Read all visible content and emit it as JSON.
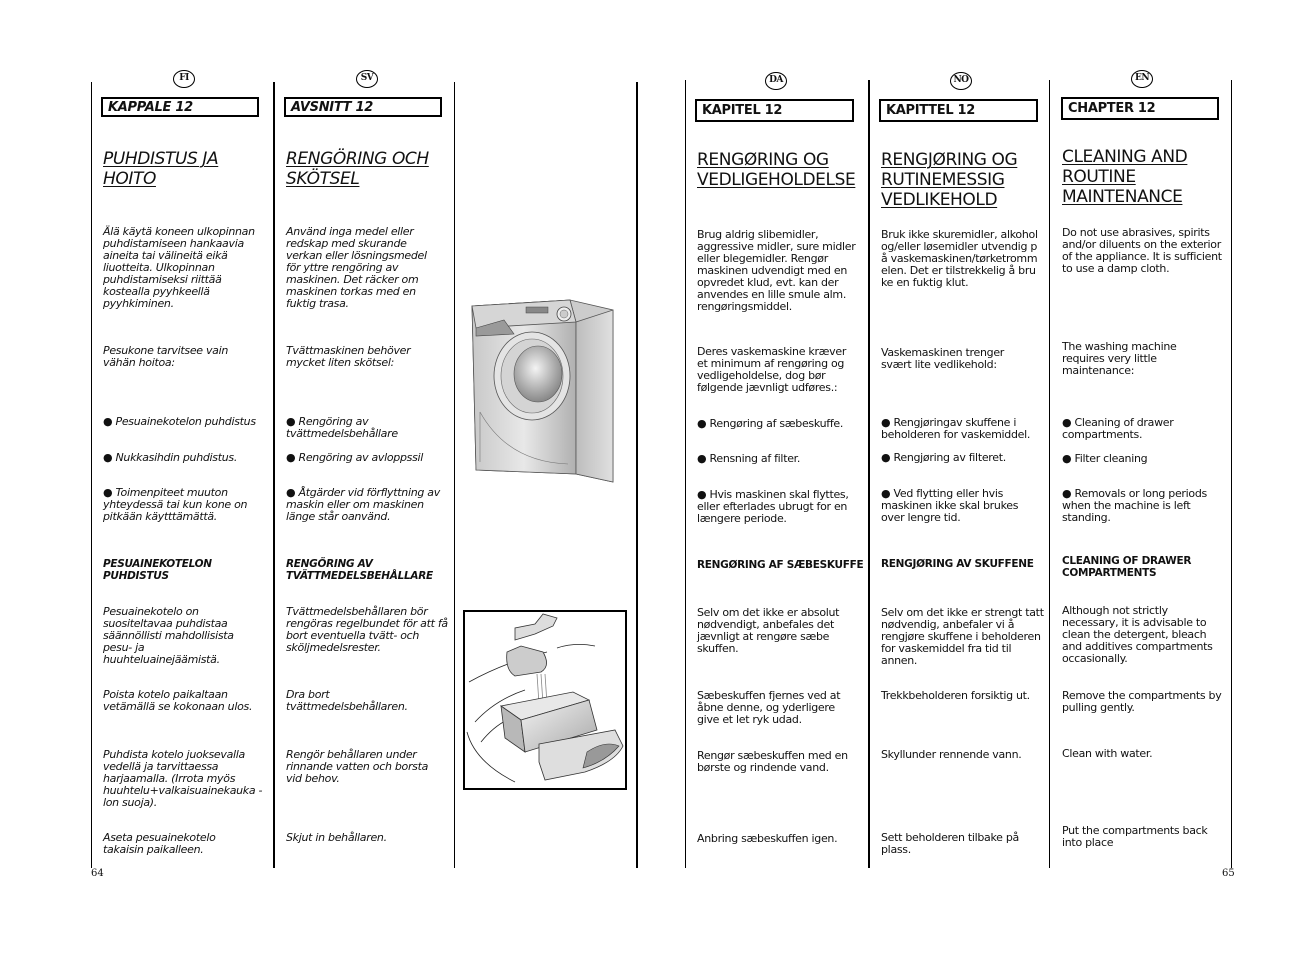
{
  "pages": {
    "left_number": "64",
    "right_number": "65"
  },
  "columns": {
    "fi": {
      "lang": "FI",
      "chapter": "KAPPALE 12",
      "title": "PUHDISTUS JA HOITO",
      "intro": "Älä käytä koneen ulkopinnan puhdistamiseen hankaavia aineita tai välineitä eikä liuotteita. Ulkopinnan puhdistamiseksi riittää kostealla pyyhkeellä pyyhkiminen.",
      "maintenance": "Pesukone tarvitsee vain vähän hoitoa:",
      "bullets": [
        "Pesuainekotelon puhdistus",
        "Nukkasihdin puhdistus.",
        "Toimenpiteet muuton yhteydessä tai kun kone on pitkään käytttämättä."
      ],
      "subheading": "PESUAINEKOTELON PUHDISTUS",
      "steps": [
        "Pesuainekotelo on suositeltavaa puhdistaa säännöllisti mahdollisista pesu- ja huuhteluainejäämistä.",
        "Poista kotelo paikaltaan vetämällä se kokonaan ulos.",
        "Puhdista kotelo juoksevalla vedellä ja tarvittaessa harjaamalla. (Irrota myös huuhtelu+valkaisuainekauka -lon suoja).",
        "Aseta pesuainekotelo takaisin paikalleen."
      ]
    },
    "sv": {
      "lang": "SV",
      "chapter": "AVSNITT 12",
      "title": "RENGÖRING OCH SKÖTSEL",
      "intro": "Använd inga medel eller redskap med skurande verkan eller lösningsmedel för yttre rengöring av maskinen. Det räcker om maskinen torkas med en fuktig trasa.",
      "maintenance": "Tvättmaskinen behöver mycket liten skötsel:",
      "bullets": [
        "Rengöring av tvättmedelsbehållare",
        "Rengöring av avloppssil",
        "Åtgärder vid förflyttning av maskin eller om maskinen länge står oanvänd."
      ],
      "subheading": "RENGÖRING AV TVÄTTMEDELSBEHÅLLARE",
      "steps": [
        "Tvättmedelsbehållaren bör rengöras regelbundet för att få bort eventuella tvätt- och sköljmedelsrester.",
        "Dra bort tvättmedelsbehållaren.",
        "Rengör behållaren under rinnande vatten och borsta vid behov.",
        "Skjut in behållaren."
      ]
    },
    "da": {
      "lang": "DA",
      "chapter": "KAPITEL 12",
      "title": "RENGØRING OG VEDLIGEHOLDELSE",
      "intro": "Brug aldrig slibemidler, aggressive midler, sure midler eller blegemidler. Rengør maskinen udvendigt med en opvredet klud, evt. kan der anvendes en lille smule alm. rengøringsmiddel.",
      "maintenance": "Deres vaskemaskine kræver et minimum af rengøring og vedligeholdelse, dog bør følgende jævnligt udføres.:",
      "bullets": [
        "Rengøring af sæbeskuffe.",
        "Rensning af filter.",
        "Hvis maskinen skal flyttes, eller efterlades ubrugt for en længere periode."
      ],
      "subheading": "RENGØRING AF SÆBESKUFFE",
      "steps": [
        "Selv om det ikke er absolut nødvendigt, anbefales det jævnligt at rengøre sæbe skuffen.",
        "Sæbeskuffen fjernes ved at åbne denne, og yderligere give et let ryk udad.",
        "Rengør sæbeskuffen med en børste og rindende vand.",
        "Anbring sæbeskuffen igen."
      ]
    },
    "no": {
      "lang": "NO",
      "chapter": "KAPITTEL 12",
      "title": "RENGJØRING OG RUTINEMESSIG VEDLIKEHOLD",
      "intro": "Bruk ikke skuremidler, alkohol og/eller løsemidler utvendig på vaskemaskinen/tørketromm elen. Det er tilstrekkelig å bruke en fuktig klut.",
      "maintenance": "Vaskemaskinen trenger svært lite vedlikehold:",
      "bullets": [
        "Rengjøringav skuffene i beholderen for vaskemiddel.",
        "Rengjøring av filteret.",
        "Ved flytting eller hvis maskinen ikke skal brukes over lengre tid."
      ],
      "subheading": "RENGJØRING AV SKUFFENE",
      "steps": [
        "Selv om det ikke er strengt tatt nødvendig, anbefaler vi å rengjøre skuffene i beholderen for vaskemiddel fra tid til annen.",
        "Trekkbeholderen forsiktig ut.",
        "Skyllunder rennende vann.",
        "Sett beholderen tilbake på plass."
      ]
    },
    "en": {
      "lang": "EN",
      "chapter": "CHAPTER 12",
      "title": "CLEANING AND ROUTINE MAINTENANCE",
      "intro": "Do not use abrasives, spirits and/or diluents on the exterior of the appliance. It is sufficient to use a damp cloth.",
      "maintenance": "The washing machine requires very little maintenance:",
      "bullets": [
        "Cleaning of drawer compartments.",
        "Filter cleaning",
        "Removals or long periods when the machine is left standing."
      ],
      "subheading": "CLEANING OF DRAWER COMPARTMENTS",
      "steps": [
        "Although not strictly necessary, it is advisable to clean the detergent, bleach and additives compartments occasionally.",
        "Remove the compartments by pulling gently.",
        "Clean with water.",
        "Put the compartments back into place"
      ]
    }
  },
  "figures": {
    "washing_machine": "washing-machine-illustration",
    "drawer_tap": "detergent-drawer-under-tap-illustration"
  }
}
